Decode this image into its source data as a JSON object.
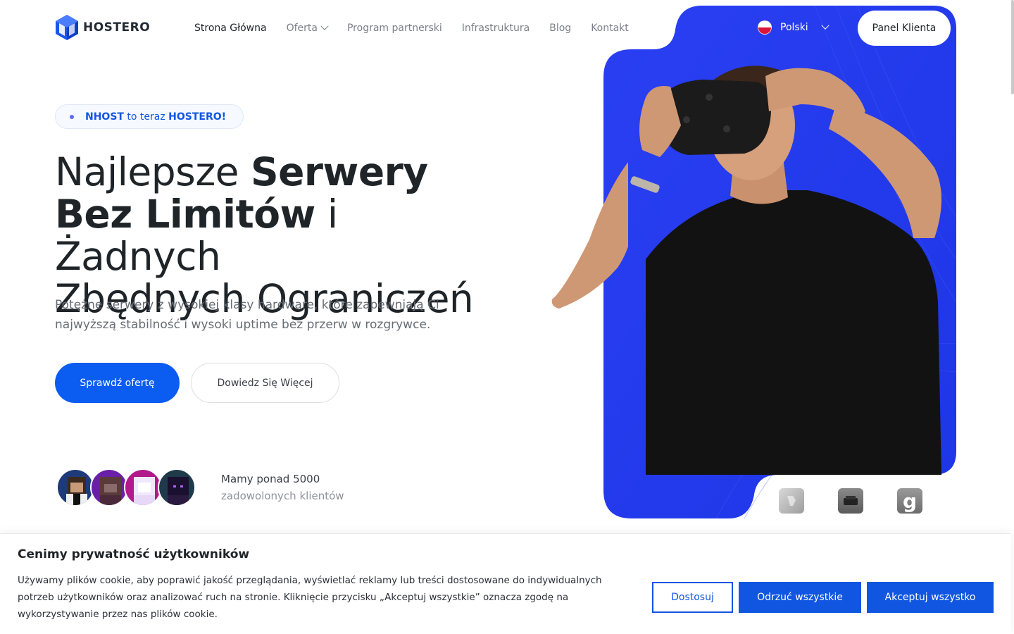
{
  "brand": {
    "name": "HOSTERO",
    "accent": "#0b5cf0",
    "panel_color": "#1f3df0"
  },
  "nav": {
    "items": [
      {
        "label": "Strona Główna"
      },
      {
        "label": "Oferta"
      },
      {
        "label": "Program partnerski"
      },
      {
        "label": "Infrastruktura"
      },
      {
        "label": "Blog"
      },
      {
        "label": "Kontakt"
      }
    ]
  },
  "header": {
    "language": "Polski",
    "panel_button": "Panel Klienta"
  },
  "hero": {
    "badge_bold_1": "NHOST",
    "badge_middle": " to teraz ",
    "badge_bold_2": "HOSTERO!",
    "headline_1": "Najlepsze ",
    "headline_bold_1": "Serwery",
    "headline_bold_2": "Bez Limitów",
    "headline_2": " i Żadnych",
    "headline_3": "Zbędnych Ograniczeń",
    "lead": "Potężne serwery z wysokiej klasy hardware, które zapewniają Ci najwyższą stabilność i wysoki uptime bez przerw w rozgrywce.",
    "primary_button": "Sprawdź ofertę",
    "secondary_button": "Dowiedz Się Więcej",
    "clients_line_1": "Mamy ponad 5000",
    "clients_line_2": "zadowolonych klientów",
    "game_icon_3": "g"
  },
  "cookie": {
    "title": "Cenimy prywatność użytkowników",
    "text": "Używamy plików cookie, aby poprawić jakość przeglądania, wyświetlać reklamy lub treści dostosowane do indywidualnych potrzeb użytkowników oraz analizować ruch na stronie. Kliknięcie przycisku „Akceptuj wszystkie” oznacza zgodę na wykorzystywanie przez nas plików cookie.",
    "customize": "Dostosuj",
    "reject": "Odrzuć wszystkie",
    "accept": "Akceptuj wszystko"
  }
}
